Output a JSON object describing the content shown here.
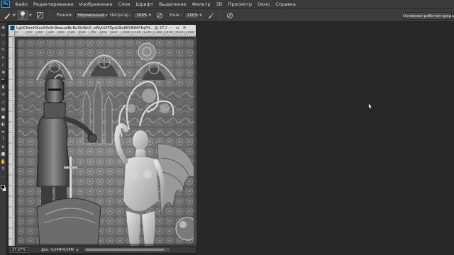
{
  "app": {
    "logo": "Ps"
  },
  "menu": [
    "Файл",
    "Редактирование",
    "Изображение",
    "Слои",
    "Шрифт",
    "Выделение",
    "Фильтр",
    "3D",
    "Просмотр",
    "Окно",
    "Справка"
  ],
  "options": {
    "brush_size": "21",
    "mode_label": "Режим:",
    "mode_value": "Нормальный",
    "opacity_label": "Непрозр.:",
    "opacity_value": "100%",
    "flow_label": "Наж.:",
    "flow_value": "100%",
    "workspace": "Основная рабочая среда"
  },
  "document": {
    "title": "LgUCHenHXxoXRx9n9weuwBnRu3IcWkO_aWyUi2FZpsLWuKKVBtNY4qYH... @ 27,3% (Слой 0, RGB/8)",
    "ruler_labels": [
      "0",
      "100",
      "200",
      "300",
      "400",
      "500",
      "600",
      "700",
      "800",
      "900",
      "1000",
      "1100",
      "1200",
      "1300",
      "1400",
      "1500",
      "1600"
    ],
    "zoom": "27,27%",
    "info": "Док: 4,54M/4,54M"
  },
  "colors": {
    "foreground": "#000000",
    "background": "#ffffff"
  },
  "icons": {
    "tools": [
      "move-icon",
      "marquee-icon",
      "lasso-icon",
      "quick-select-icon",
      "crop-icon",
      "eyedropper-icon",
      "healing-icon",
      "brush-icon",
      "stamp-icon",
      "history-brush-icon",
      "eraser-icon",
      "gradient-icon",
      "blur-icon",
      "dodge-icon",
      "pen-icon",
      "type-icon",
      "path-select-icon",
      "shape-icon",
      "hand-icon",
      "zoom-icon"
    ]
  }
}
